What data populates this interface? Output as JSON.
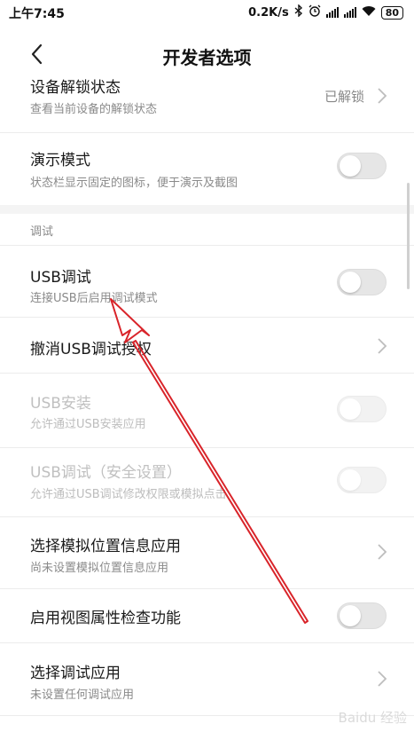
{
  "status_bar": {
    "time": "上午7:45",
    "speed": "0.2K/s",
    "battery": "80",
    "icons": [
      "bluetooth-icon",
      "alarm-icon",
      "signal-icon",
      "signal-icon",
      "wifi-icon",
      "battery-icon"
    ]
  },
  "header": {
    "title": "开发者选项"
  },
  "rows": {
    "unlock": {
      "title": "设备解锁状态",
      "subtitle": "查看当前设备的解锁状态",
      "value": "已解锁"
    },
    "demo": {
      "title": "演示模式",
      "subtitle": "状态栏显示固定的图标，便于演示及截图",
      "toggle_on": false
    },
    "section_debug": "调试",
    "usb_debug": {
      "title": "USB调试",
      "subtitle": "连接USB后启用调试模式",
      "toggle_on": false
    },
    "revoke": {
      "title": "撤消USB调试授权"
    },
    "usb_install": {
      "title": "USB安装",
      "subtitle": "允许通过USB安装应用",
      "toggle_on": false,
      "enabled": false
    },
    "usb_secure": {
      "title": "USB调试（安全设置）",
      "subtitle": "允许通过USB调试修改权限或模拟点击",
      "toggle_on": false,
      "enabled": false
    },
    "mock_location": {
      "title": "选择模拟位置信息应用",
      "subtitle": "尚未设置模拟位置信息应用"
    },
    "view_attr": {
      "title": "启用视图属性检查功能",
      "toggle_on": false
    },
    "debug_app": {
      "title": "选择调试应用",
      "subtitle": "未设置任何调试应用"
    }
  },
  "colors": {
    "annotation_arrow": "#d9242a",
    "toggle_off": "#e6e6e6",
    "section_bg": "#f4f4f4"
  },
  "watermark": "Baidu 经验"
}
